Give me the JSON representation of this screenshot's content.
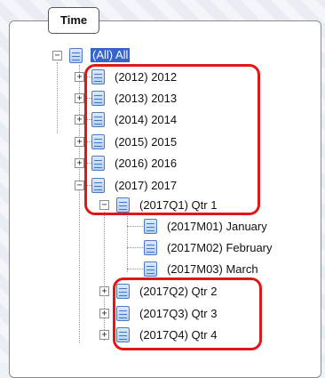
{
  "panel": {
    "title": "Time"
  },
  "tree": {
    "root": "(All) All",
    "years": [
      "(2012) 2012",
      "(2013) 2013",
      "(2014) 2014",
      "(2015) 2015",
      "(2016) 2016",
      "(2017) 2017"
    ],
    "q1": "(2017Q1) Qtr 1",
    "months": [
      "(2017M01) January",
      "(2017M02) February",
      "(2017M03) March"
    ],
    "quarters": [
      "(2017Q2) Qtr 2",
      "(2017Q3) Qtr 3",
      "(2017Q4) Qtr 4"
    ]
  },
  "colors": {
    "highlight": "#e01717",
    "selection": "#3366cc",
    "icon": "#4a7cc4"
  }
}
